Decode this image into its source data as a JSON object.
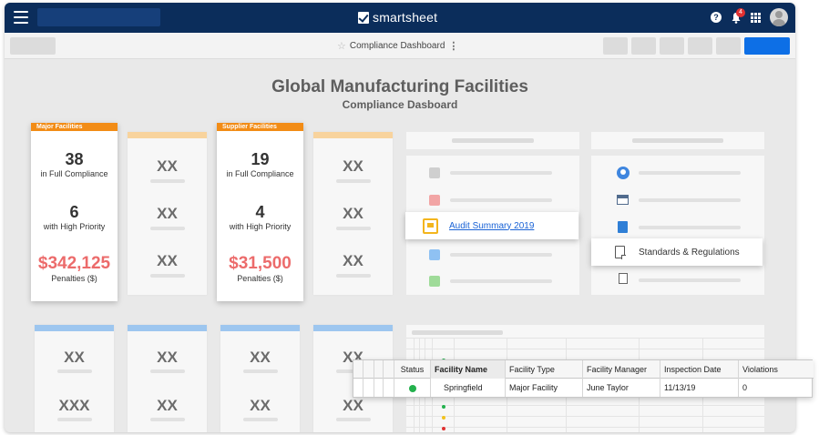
{
  "app": {
    "brand": "smartsheet",
    "notification_count": "4",
    "sheet_title": "Compliance Dashboard"
  },
  "dashboard": {
    "title": "Global Manufacturing Facilities",
    "subtitle": "Compliance Dasboard"
  },
  "major_card": {
    "tag": "Major Facilities",
    "compliance_count": "38",
    "compliance_label": "in Full Compliance",
    "priority_count": "6",
    "priority_label": "with High Priority",
    "penalties_amount": "$342,125",
    "penalties_label": "Penalties ($)"
  },
  "supplier_card": {
    "tag": "Supplier Facilities",
    "compliance_count": "19",
    "compliance_label": "in Full Compliance",
    "priority_count": "4",
    "priority_label": "with High Priority",
    "penalties_amount": "$31,500",
    "penalties_label": "Penalties ($)"
  },
  "placeholders": {
    "xx": "XX",
    "xxx": "XXX"
  },
  "links": {
    "audit_summary": "Audit Summary 2019",
    "standards": "Standards & Regulations"
  },
  "sheet_table": {
    "columns": [
      "Status",
      "Facility Name",
      "Facility Type",
      "Facility Manager",
      "Inspection Date",
      "Violations"
    ],
    "row": {
      "status_color": "#23b14d",
      "facility_name": "Springfield",
      "facility_type": "Major Facility",
      "facility_manager": "June Taylor",
      "inspection_date": "11/13/19",
      "violations": "0"
    }
  },
  "colors": {
    "topbar": "#0b2d5b",
    "primary_button": "#0d6fe6",
    "orange_tag": "#f28c16",
    "penalty_text": "#ec6b6b",
    "link": "#1a63d6"
  }
}
